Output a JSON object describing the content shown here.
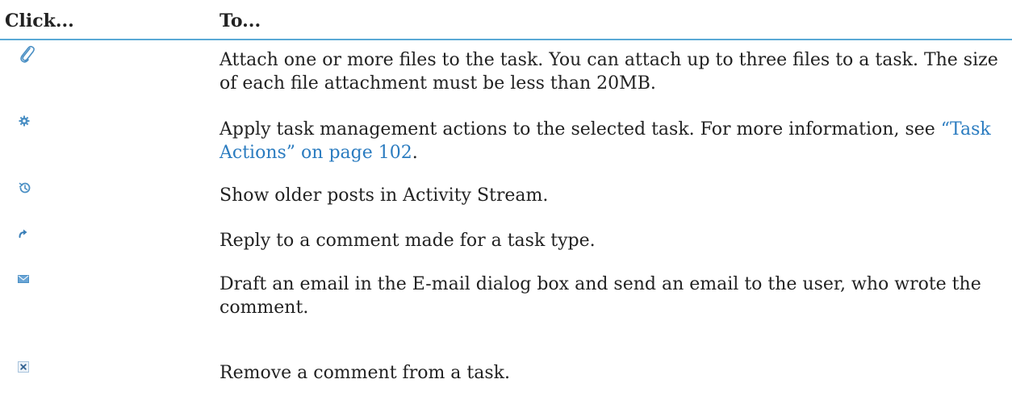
{
  "header": {
    "col1": "Click...",
    "col2": "To..."
  },
  "rows": [
    {
      "icon": "paperclip-icon",
      "text": "Attach one or more files to the task. You can attach up to three files to a task. The size of each file attachment must be less than 20MB."
    },
    {
      "icon": "gear-icon",
      "text_before": "Apply task management actions to the selected task. For more information, see ",
      "link": "“Task Actions” on page 102",
      "text_after": "."
    },
    {
      "icon": "history-icon",
      "text": "Show older posts in Activity Stream."
    },
    {
      "icon": "reply-arrow-icon",
      "text": "Reply to a comment made for a task type."
    },
    {
      "icon": "envelope-icon",
      "text": "Draft an email in the E-mail dialog box and send an email to the user, who wrote the comment."
    },
    {
      "icon": "remove-x-icon",
      "text": "Remove a comment from a task."
    }
  ],
  "colors": {
    "rule": "#5aa9d6",
    "link": "#2b7cc0",
    "icon": "#4a8fc4"
  }
}
